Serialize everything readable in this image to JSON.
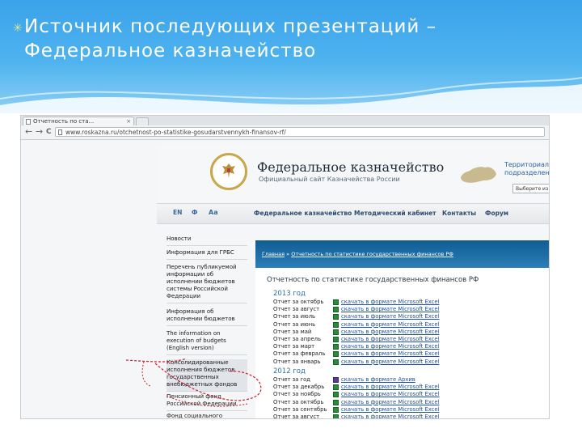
{
  "slide": {
    "title": "Источник последующих презентаций – Федеральное казначейство",
    "bullet": "✳"
  },
  "browser": {
    "tab_title": "Отчетность по ста...",
    "tab_close": "×",
    "url": "www.roskazna.ru/otchetnost-po-statistike-gosudarstvennykh-finansov-rf/",
    "back": "←",
    "forward": "→",
    "reload": "C"
  },
  "site": {
    "name": "Федеральное казначейство",
    "subtitle": "Официальный сайт Казначейства России",
    "territory_line1": "Территориал",
    "territory_line2": "подразделения",
    "select_value": "Выберите из"
  },
  "nav": {
    "lang": "EN",
    "symbol": "Ф",
    "font": "Аа",
    "items": [
      "Федеральное казначейство",
      "Методический кабинет",
      "Контакты",
      "Форум"
    ]
  },
  "sidebar": {
    "items": [
      "Новости",
      "Информация для ГРБС",
      "Перечень публикуемой информации об исполнении бюджетов системы Российской Федерации",
      "Информация об исполнении бюджетов",
      "The information on execution of budgets (English version)",
      "Консолидированные исполнения бюджетов государственных внебюджетных фондов",
      "Пенсионный фонд Российской Федерации",
      "Фонд социального"
    ]
  },
  "main": {
    "crumb_home": "Главная",
    "crumb_sep": "»",
    "crumb_current": "Отчетность по статистике государственных финансов РФ",
    "title": "Отчетность по статистике государственных финансов РФ",
    "year_2013": "2013 год",
    "year_2012": "2012 год",
    "reports_2013": [
      {
        "name": "Отчет за октябрь",
        "link": "скачать в формате Microsoft Excel"
      },
      {
        "name": "Отчет за август",
        "link": "скачать в формате Microsoft Excel"
      },
      {
        "name": "Отчет за июль",
        "link": "скачать в формате Microsoft Excel"
      },
      {
        "name": "Отчет за июнь",
        "link": "скачать в формате Microsoft Excel"
      },
      {
        "name": "Отчет за май",
        "link": "скачать в формате Microsoft Excel"
      },
      {
        "name": "Отчет за апрель",
        "link": "скачать в формате Microsoft Excel"
      },
      {
        "name": "Отчет за март",
        "link": "скачать в формате Microsoft Excel"
      },
      {
        "name": "Отчет за февраль",
        "link": "скачать в формате Microsoft Excel"
      },
      {
        "name": "Отчет за январь",
        "link": "скачать в формате Microsoft Excel"
      }
    ],
    "reports_2012": [
      {
        "name": "Отчет за год",
        "link": "скачать в формате Архив",
        "archive": true
      },
      {
        "name": "Отчет за декабрь",
        "link": "скачать в формате Microsoft Excel"
      },
      {
        "name": "Отчет за ноябрь",
        "link": "скачать в формате Microsoft Excel"
      },
      {
        "name": "Отчет за октябрь",
        "link": "скачать в формате Microsoft Excel"
      },
      {
        "name": "Отчет за сентябрь",
        "link": "скачать в формате Microsoft Excel"
      },
      {
        "name": "Отчет за август",
        "link": "скачать в формате Microsoft Excel"
      }
    ]
  },
  "colors": {
    "slide_blue": "#3aa2ea",
    "site_header_blue": "#0f5d93",
    "link_blue": "#1d4f99",
    "annotation_red": "#cc1f2e",
    "excel_green": "#2a8a3a"
  }
}
